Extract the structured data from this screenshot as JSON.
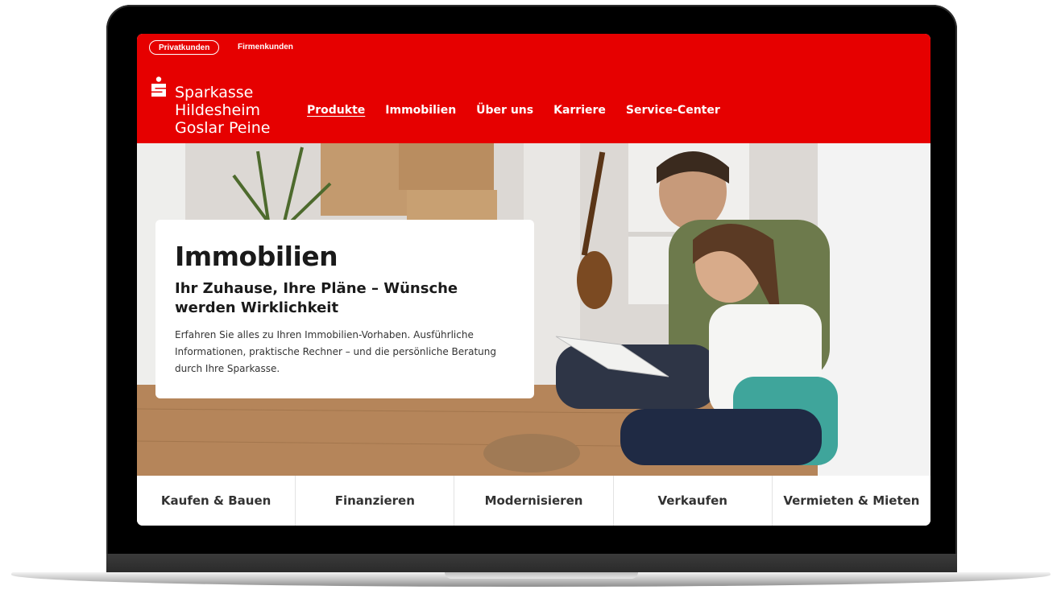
{
  "segments": {
    "active": "Privatkunden",
    "other": "Firmenkunden"
  },
  "brand": {
    "line1": "Sparkasse",
    "line2": "Hildesheim",
    "line3": "Goslar Peine",
    "logo_icon": "sparkasse-s-logo"
  },
  "nav": {
    "items": [
      {
        "label": "Produkte",
        "active": true
      },
      {
        "label": "Immobilien",
        "active": false
      },
      {
        "label": "Über uns",
        "active": false
      },
      {
        "label": "Karriere",
        "active": false
      },
      {
        "label": "Service-Center",
        "active": false
      }
    ]
  },
  "hero": {
    "title": "Immobilien",
    "subtitle": "Ihr Zuhause, Ihre Pläne – Wünsche werden Wirklichkeit",
    "text": "Erfahren Sie alles zu Ihren Immobilien-Vorhaben. Ausführliche Informationen, praktische Rechner – und die persönliche Beratung durch Ihre Sparkasse.",
    "image": "father-and-daughter-reading-book-on-floor"
  },
  "categories": [
    {
      "label": "Kaufen & Bauen"
    },
    {
      "label": "Finanzieren"
    },
    {
      "label": "Modernisieren"
    },
    {
      "label": "Verkaufen"
    },
    {
      "label": "Vermieten & Mieten"
    }
  ],
  "colors": {
    "brand_red": "#e60000",
    "text_dark": "#1a1a1a"
  }
}
